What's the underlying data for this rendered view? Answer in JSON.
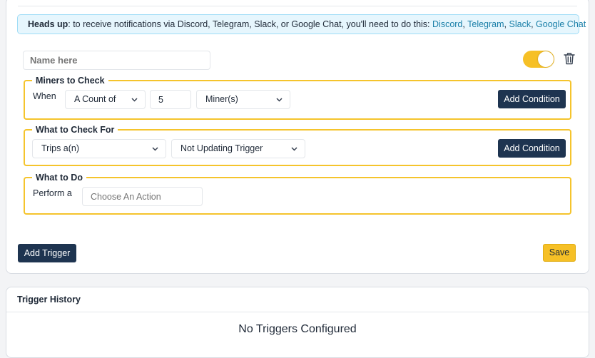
{
  "alert": {
    "bold": "Heads up",
    "text": ": to receive notifications via Discord, Telegram, Slack, or Google Chat, you'll need to do this: ",
    "links": [
      "Discord",
      "Telegram",
      "Slack",
      "Google Chat"
    ],
    "separator": ", "
  },
  "trigger": {
    "name_placeholder": "Name here",
    "enabled": true,
    "accent_color": "#f6c026"
  },
  "miners_section": {
    "legend": "Miners to Check",
    "when_label": "When",
    "count_select": "A Count of",
    "count_value": "5",
    "unit_select": "Miner(s)",
    "add_condition": "Add Condition"
  },
  "check_section": {
    "legend": "What to Check For",
    "trips_select": "Trips a(n)",
    "trigger_select": "Not Updating Trigger",
    "add_condition": "Add Condition"
  },
  "do_section": {
    "legend": "What to Do",
    "perform_label": "Perform a",
    "action_placeholder": "Choose An Action"
  },
  "footer": {
    "add_trigger": "Add Trigger",
    "save": "Save"
  },
  "history": {
    "title": "Trigger History",
    "empty": "No Triggers Configured"
  },
  "icons": {
    "trash": "trash-icon",
    "chevron": "chevron-down-icon"
  }
}
